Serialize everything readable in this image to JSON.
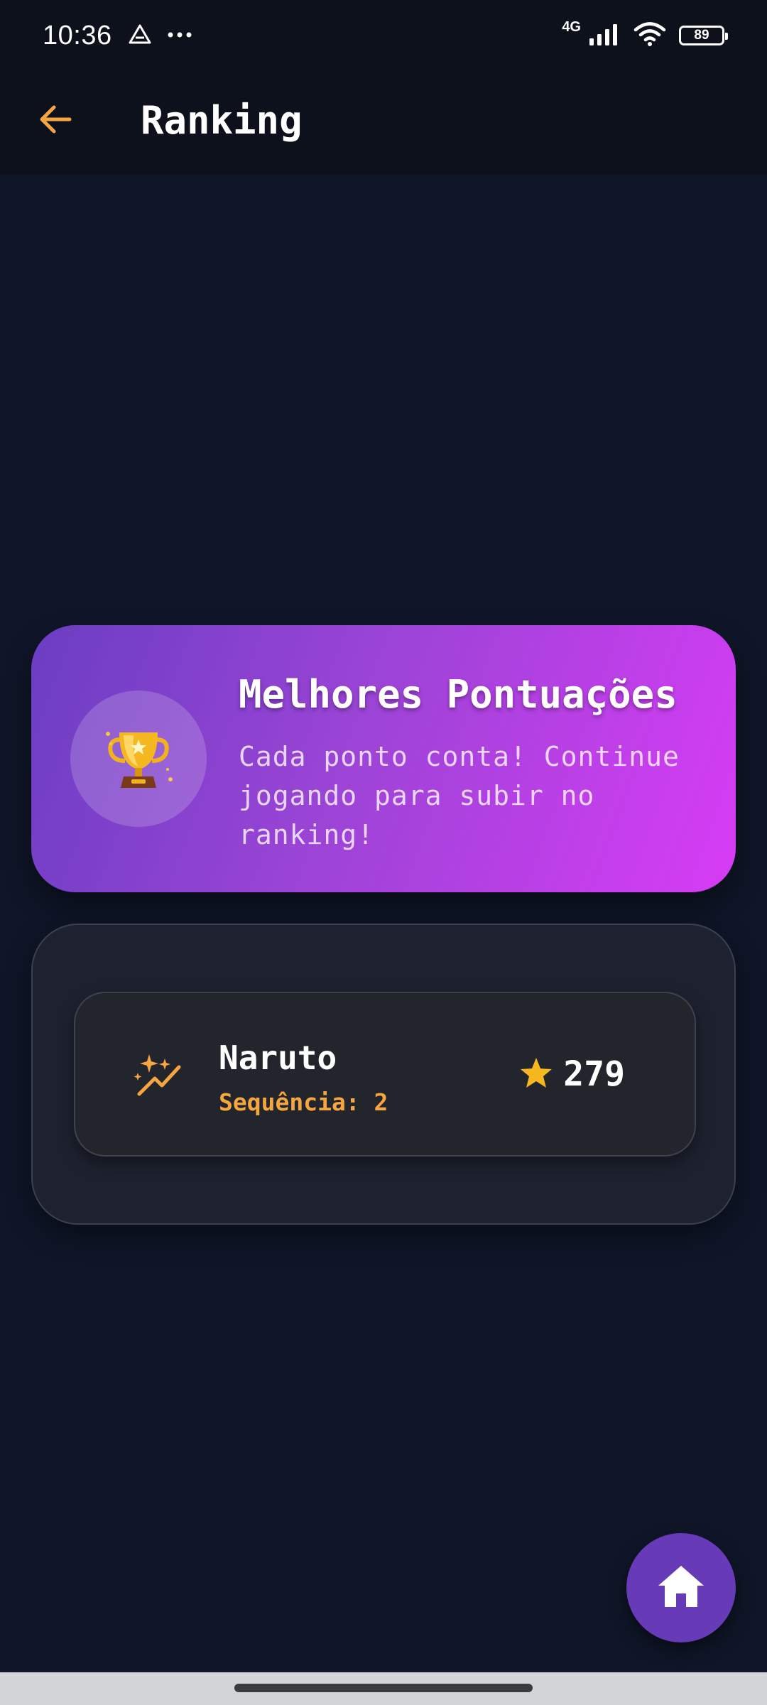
{
  "status_bar": {
    "time": "10:36",
    "network": "4G",
    "battery": "89",
    "icons": [
      "drive-icon",
      "more-dots-icon",
      "signal-icon",
      "wifi-icon",
      "battery-icon"
    ]
  },
  "app_bar": {
    "title": "Ranking",
    "back_icon": "arrow-left-icon",
    "accent": "#f5a640"
  },
  "hero": {
    "title": "Melhores Pontuações",
    "subtitle": "Cada ponto conta! Continue jogando para subir no ranking!",
    "icon": "trophy-icon",
    "gradient_start": "#6a3ec2",
    "gradient_end": "#d73cf5"
  },
  "leaderboard": {
    "entries": [
      {
        "name": "Naruto",
        "streak_label": "Sequência: 2",
        "score": "279",
        "icon": "sparkle-trend-icon",
        "score_icon": "star-icon"
      }
    ]
  },
  "fab": {
    "icon": "home-icon",
    "color": "#673ab7"
  }
}
